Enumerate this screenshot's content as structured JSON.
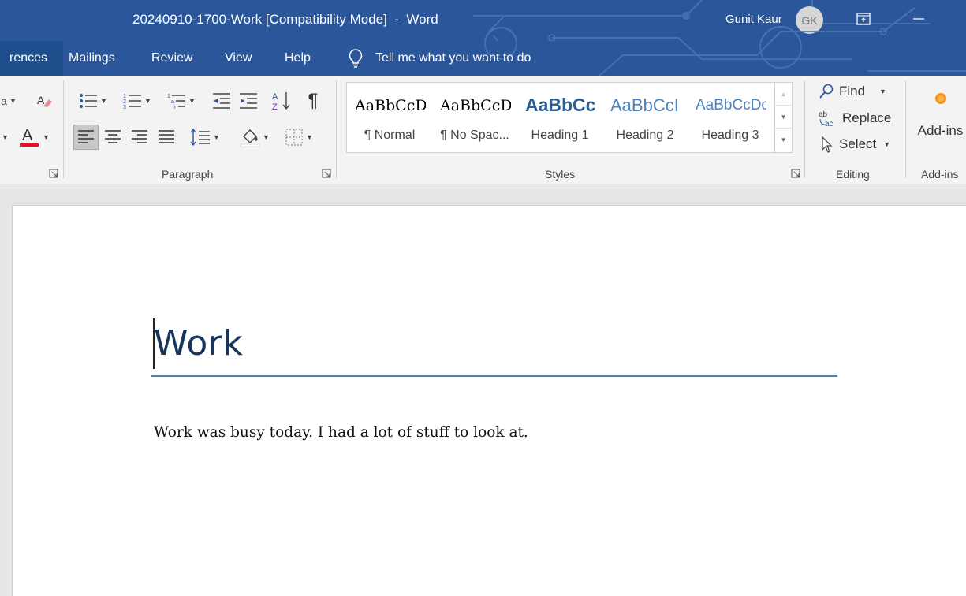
{
  "window": {
    "title": "20240910-1700-Work [Compatibility Mode]  -  Word",
    "user_name": "Gunit Kaur",
    "user_initials": "GK"
  },
  "tabs": [
    {
      "label": "rences",
      "selected": true
    },
    {
      "label": "Mailings",
      "selected": false
    },
    {
      "label": "Review",
      "selected": false
    },
    {
      "label": "View",
      "selected": false
    },
    {
      "label": "Help",
      "selected": false
    }
  ],
  "tell_me": {
    "text": "Tell me what you want to do",
    "icon": "lightbulb-icon"
  },
  "ribbon": {
    "groups": {
      "paragraph": "Paragraph",
      "styles": "Styles",
      "editing": "Editing",
      "addins": "Add-ins"
    },
    "styles": [
      {
        "preview": "AaBbCcDc",
        "name": "¶ Normal",
        "color": "#000000"
      },
      {
        "preview": "AaBbCcDc",
        "name": "¶ No Spac...",
        "color": "#000000"
      },
      {
        "preview": "AaBbCc",
        "name": "Heading 1",
        "color": "#2e5f96"
      },
      {
        "preview": "AaBbCcI",
        "name": "Heading 2",
        "color": "#4f81bd"
      },
      {
        "preview": "AaBbCcDc",
        "name": "Heading 3",
        "color": "#4f81bd"
      }
    ],
    "editing": {
      "find": "Find",
      "replace": "Replace",
      "select": "Select",
      "replace_icon_text": "ab ac"
    },
    "addins": {
      "label": "Add-ins"
    },
    "font_color": "#e81123"
  },
  "document": {
    "title": "Work",
    "body": "Work was busy today. I had a lot of stuff to look at."
  },
  "colors": {
    "accent": "#2b579a",
    "title_text": "#17365d",
    "title_rule": "#4f81bd"
  }
}
